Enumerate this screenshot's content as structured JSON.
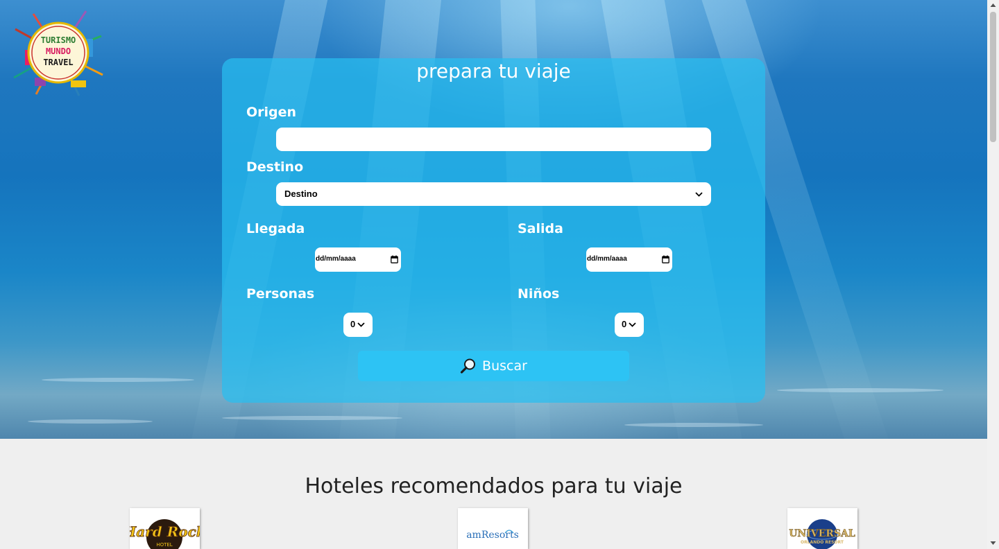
{
  "logo": {
    "line1": "TURISMO",
    "line2": "MUNDO",
    "line3": "TRAVEL"
  },
  "form": {
    "title": "prepara tu viaje",
    "origen_label": "Origen",
    "origen_value": "",
    "destino_label": "Destino",
    "destino_selected": "Destino",
    "llegada_label": "Llegada",
    "llegada_value": "dd/mm/aaaa",
    "salida_label": "Salida",
    "salida_value": "dd/mm/aaaa",
    "personas_label": "Personas",
    "personas_value": "0",
    "ninos_label": "Niños",
    "ninos_value": "0",
    "search_button": "Buscar",
    "search_icon": "magnifier-icon"
  },
  "hotels": {
    "title": "Hoteles recomendados para tu viaje",
    "items": [
      {
        "brand": "Hard Rock",
        "sub": "HOTEL"
      },
      {
        "brand": "amResorts",
        "sub": ""
      },
      {
        "brand": "UNIVERSAL",
        "sub": "ORLANDO RESORT"
      }
    ]
  },
  "colors": {
    "card": "#28bef0",
    "button": "#2dc3f4",
    "page_bg": "#efefef"
  }
}
